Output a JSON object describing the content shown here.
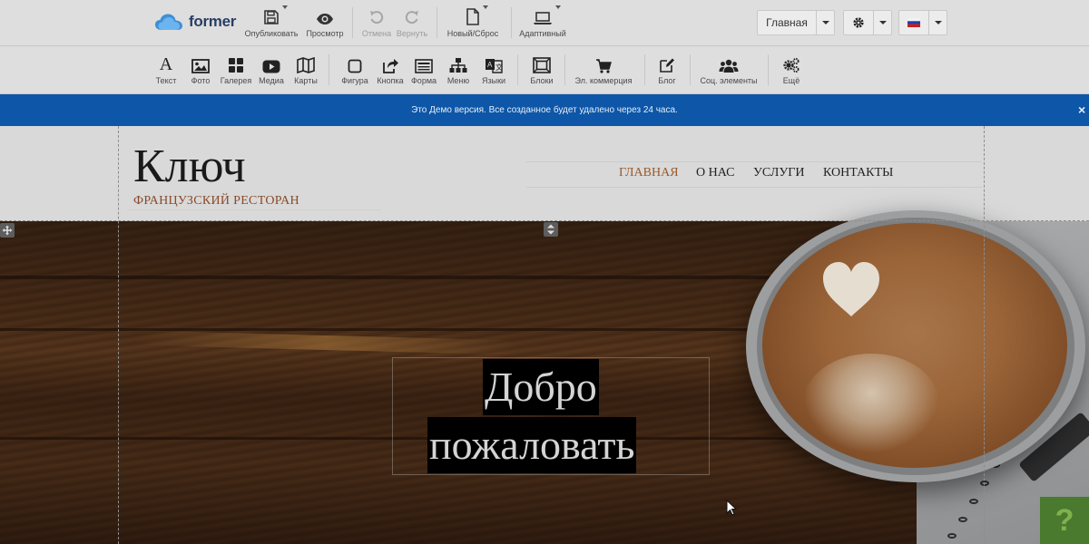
{
  "logo": {
    "text": "former"
  },
  "toolbar": {
    "publish": "Опубликовать",
    "preview": "Просмотр",
    "undo": "Отмена",
    "redo": "Вернуть",
    "new_reset": "Новый/Сброс",
    "adaptive": "Адаптивный"
  },
  "page_select": {
    "value": "Главная"
  },
  "language": {
    "flag": "russia-flag"
  },
  "elements": {
    "text": "Текст",
    "photo": "Фото",
    "gallery": "Галерея",
    "media": "Медиа",
    "maps": "Карты",
    "shape": "Фигура",
    "button": "Кнопка",
    "form": "Форма",
    "menu": "Меню",
    "languages": "Языки",
    "blocks": "Блоки",
    "ecommerce": "Эл. коммерция",
    "blog": "Блог",
    "social": "Соц. элементы",
    "more": "Ещё"
  },
  "banner": {
    "text": "Это Демо версия. Все созданное будет удалено через 24 часа.",
    "close": "×"
  },
  "site": {
    "brand": "Ключ",
    "tagline": "ФРАНЦУЗСКИЙ РЕСТОРАН",
    "nav": [
      "ГЛАВНАЯ",
      "О НАС",
      "УСЛУГИ",
      "КОНТАКТЫ"
    ],
    "hero": {
      "line1": "Добро",
      "line2": "пожаловать"
    }
  },
  "help": {
    "label": "?"
  },
  "colors": {
    "banner": "#0d56a8",
    "nav_active": "#9a5a2a",
    "tagline": "#8a4a2a",
    "logo": "#2a3e63"
  }
}
